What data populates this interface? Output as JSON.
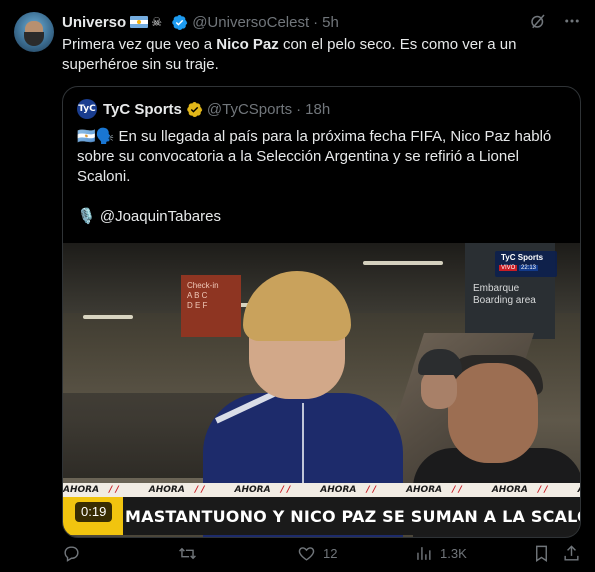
{
  "tweet": {
    "author_name": "Universo",
    "handle": "@UniversoCelest",
    "separator": "·",
    "time": "5h",
    "text_before": "Primera vez que veo a ",
    "text_bold": "Nico Paz",
    "text_after": " con el pelo seco. Es como ver a un superhéroe sin su traje."
  },
  "quote": {
    "avatar_label": "TyC",
    "author_name": "TyC Sports",
    "handle": "@TyCSports",
    "separator": "·",
    "time": "18h",
    "line1": "🇦🇷🗣️ En su llegada al país para la próxima fecha FIFA, Nico Paz habló sobre su convocatoria a la Selección Argentina y se refirió a Lionel Scaloni.",
    "line2": "🎙️ @JoaquinTabares",
    "video": {
      "signs": {
        "checkin": "Check-in\nA B C\nD E F",
        "embarque": "Embarque\nBoarding area"
      },
      "bug": {
        "brand": "TyC Sports",
        "live": "VIVO",
        "clock": "22:13"
      },
      "ticker_word": "AHORA",
      "banner": "MASTANTUONO Y NICO PAZ SE SUMAN A LA SCALONETA",
      "duration": "0:19"
    }
  },
  "actions": {
    "reply_count": "",
    "retweet_count": "",
    "like_count": "12",
    "views_count": "1.3K"
  },
  "colors": {
    "background": "#000000",
    "text": "#e7e9ea",
    "muted": "#71767b",
    "verified": "#1d9bf0",
    "border": "#2f3336"
  }
}
